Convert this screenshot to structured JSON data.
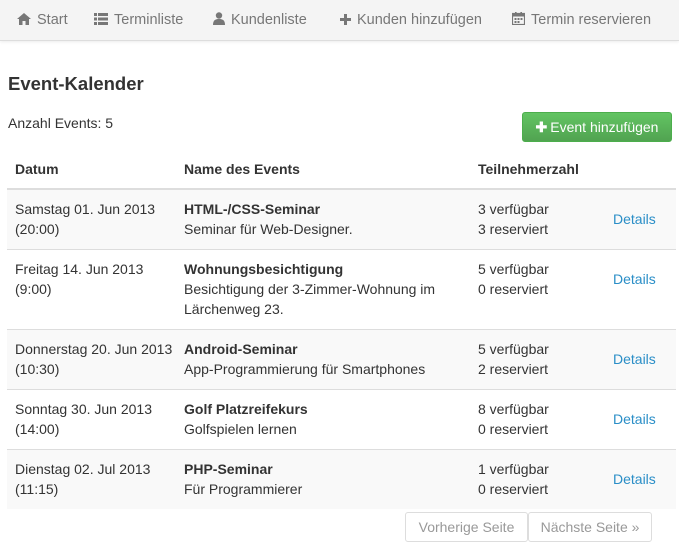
{
  "nav": {
    "items": [
      {
        "label": "Start",
        "icon": "home-icon"
      },
      {
        "label": "Terminliste",
        "icon": "list-icon"
      },
      {
        "label": "Kundenliste",
        "icon": "user-icon"
      },
      {
        "label": "Kunden hinzufügen",
        "icon": "plus-icon"
      },
      {
        "label": "Termin reservieren",
        "icon": "calendar-icon"
      }
    ]
  },
  "page": {
    "title": "Event-Kalender",
    "count_label": "Anzahl Events: 5",
    "add_button": "Event hinzufügen"
  },
  "table": {
    "headers": [
      "Datum",
      "Name des Events",
      "Teilnehmerzahl"
    ],
    "details_label": "Details",
    "rows": [
      {
        "date": "Samstag 01. Jun 2013 (20:00)",
        "name": "HTML-/CSS-Seminar",
        "desc": "Seminar für Web-Designer.",
        "available": "3 verfügbar",
        "reserved": "3 reserviert"
      },
      {
        "date": "Freitag 14. Jun 2013 (9:00)",
        "name": "Wohnungsbesichtigung",
        "desc": "Besichtigung der 3-Zimmer-Wohnung im Lärchenweg 23.",
        "available": "5 verfügbar",
        "reserved": "0 reserviert"
      },
      {
        "date": "Donnerstag 20. Jun 2013 (10:30)",
        "name": "Android-Seminar",
        "desc": "App-Programmierung für Smartphones",
        "available": "5 verfügbar",
        "reserved": "2 reserviert"
      },
      {
        "date": "Sonntag 30. Jun 2013 (14:00)",
        "name": "Golf Platzreifekurs",
        "desc": "Golfspielen lernen",
        "available": "8 verfügbar",
        "reserved": "0 reserviert"
      },
      {
        "date": "Dienstag 02. Jul 2013 (11:15)",
        "name": "PHP-Seminar",
        "desc": "Für Programmierer",
        "available": "1 verfügbar",
        "reserved": "0 reserviert"
      }
    ]
  },
  "pagination": {
    "prev": "Vorherige Seite",
    "next": "Nächste Seite »"
  },
  "colors": {
    "link": "#2a8ec7",
    "button_green": "#5cb85c",
    "nav_text": "#777777"
  }
}
